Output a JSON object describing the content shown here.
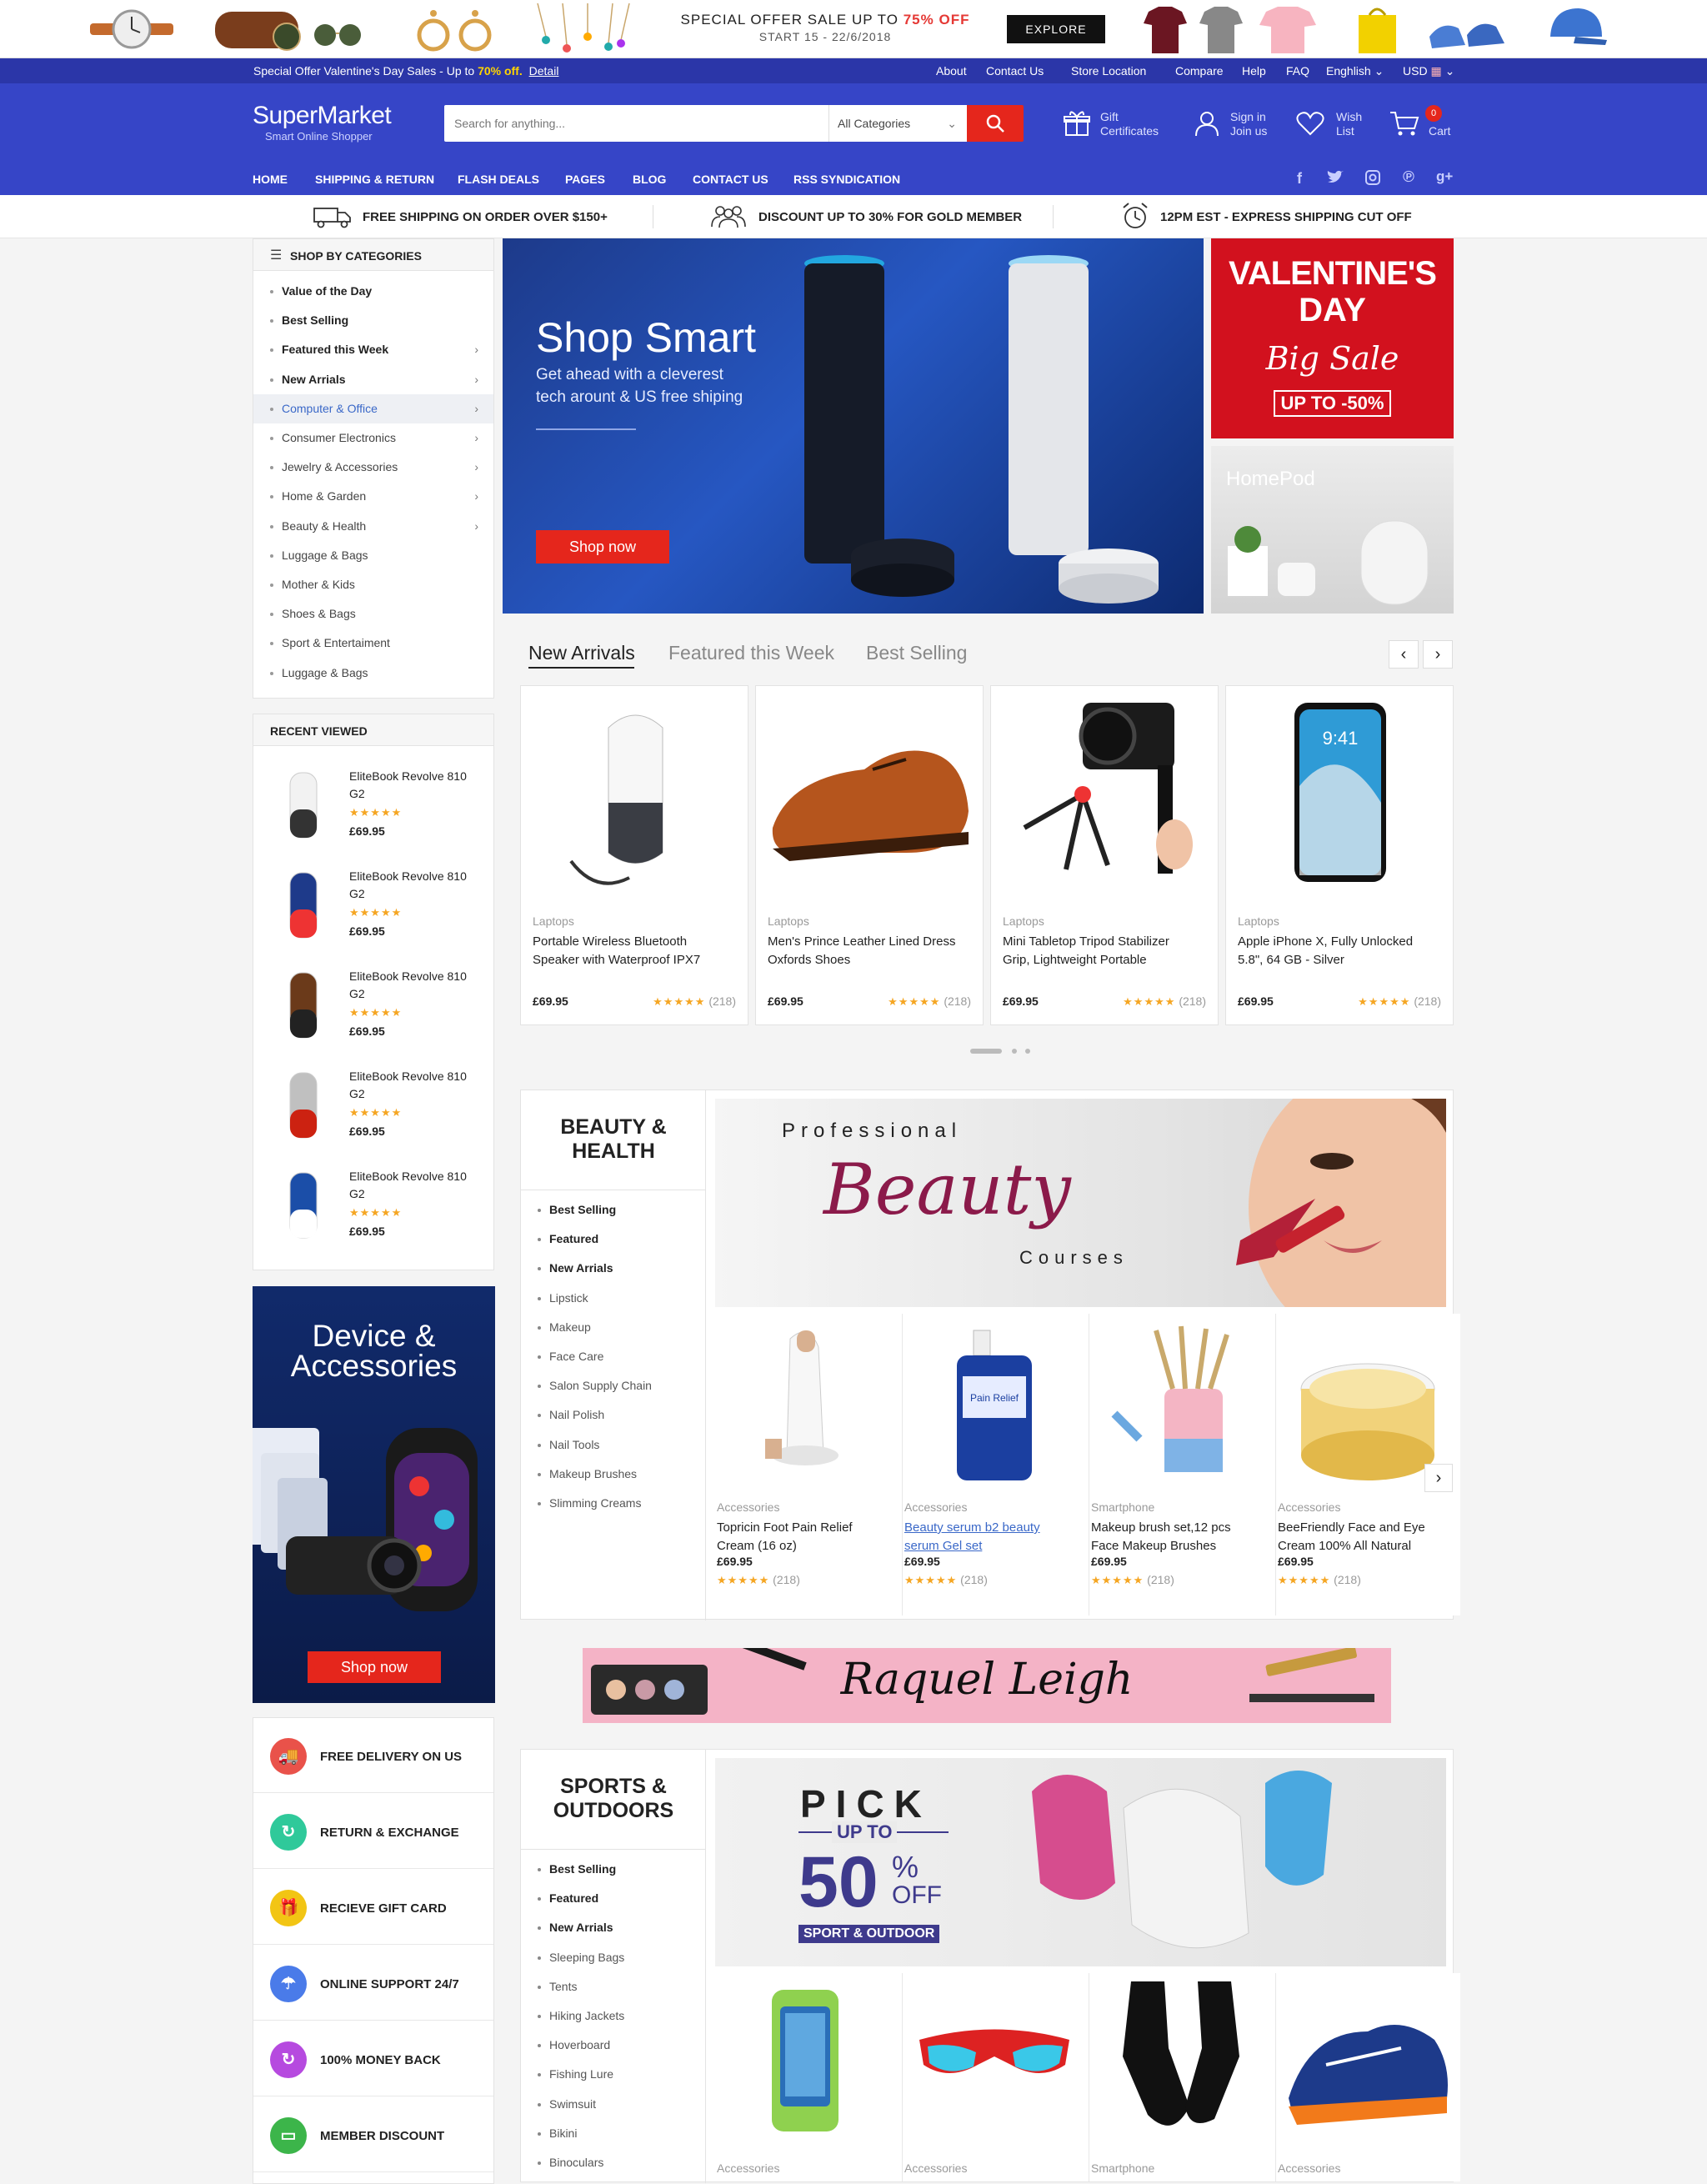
{
  "top_banner": {
    "offer_line1": "SPECIAL OFFER  SALE UP TO ",
    "offer_pct": "75% OFF",
    "offer_line2": "START 15 - 22/6/2018",
    "explore_label": "EXPLORE"
  },
  "topbar": {
    "promo_prefix": "Special Offer Valentine's Day Sales - Up to ",
    "promo_pct": "70% off.",
    "promo_link": "Detail",
    "links": [
      "About",
      "Contact Us",
      "Store Location",
      "Compare",
      "Help",
      "FAQ"
    ],
    "language": "Enghlish",
    "currency": "USD"
  },
  "header": {
    "logo": "SuperMarket",
    "tagline": "Smart Online Shopper",
    "search_placeholder": "Search for anything...",
    "category_select": "All Categories",
    "gift_line1": "Gift",
    "gift_line2": "Certificates",
    "sign_line1": "Sign in",
    "sign_line2": "Join us",
    "wish_line1": "Wish",
    "wish_line2": "List",
    "cart_label": "Cart",
    "cart_count": "0",
    "nav": [
      "HOME",
      "SHIPPING & RETURN",
      "FLASH DEALS",
      "PAGES",
      "BLOG",
      "CONTACT US",
      "RSS SYNDICATION"
    ],
    "social_icons": [
      "facebook-icon",
      "twitter-icon",
      "instagram-icon",
      "pinterest-icon",
      "google-plus-icon"
    ]
  },
  "features": [
    "FREE SHIPPING ON ORDER OVER $150+",
    "DISCOUNT UP TO 30% FOR GOLD MEMBER",
    "12PM EST - EXPRESS SHIPPING CUT OFF"
  ],
  "categories": {
    "title": "SHOP BY CATEGORIES",
    "items": [
      {
        "label": "Value of the Day",
        "arrow": false,
        "bold": true
      },
      {
        "label": "Best Selling",
        "arrow": false,
        "bold": true
      },
      {
        "label": "Featured this Week",
        "arrow": true,
        "bold": true
      },
      {
        "label": "New Arrials",
        "arrow": true,
        "bold": true
      },
      {
        "label": "Computer & Office",
        "arrow": true,
        "active": true
      },
      {
        "label": "Consumer Electronics",
        "arrow": true
      },
      {
        "label": "Jewelry & Accessories",
        "arrow": true
      },
      {
        "label": "Home & Garden",
        "arrow": true
      },
      {
        "label": "Beauty & Health",
        "arrow": true
      },
      {
        "label": "Luggage & Bags",
        "arrow": false
      },
      {
        "label": "Mother & Kids",
        "arrow": false
      },
      {
        "label": "Shoes & Bags",
        "arrow": false
      },
      {
        "label": "Sport & Entertaiment",
        "arrow": false
      },
      {
        "label": "Luggage & Bags",
        "arrow": false
      }
    ]
  },
  "hero": {
    "title": "Shop Smart",
    "subtitle_line1": "Get ahead with a cleverest",
    "subtitle_line2": "tech arount & US free shiping",
    "button": "Shop now"
  },
  "side_banners": {
    "valentine_line1": "VALENTINE'S",
    "valentine_line2": "DAY",
    "valentine_script": "Big Sale",
    "valentine_offer": "UP TO -50%",
    "homepod": "HomePod"
  },
  "recent_viewed": {
    "title": "RECENT VIEWED",
    "items": [
      {
        "name_line1": "EliteBook Revolve 810",
        "name_line2": "G2",
        "rating": "★★★★★",
        "price": "£69.95"
      },
      {
        "name_line1": "EliteBook Revolve 810",
        "name_line2": "G2",
        "rating": "★★★★★",
        "price": "£69.95"
      },
      {
        "name_line1": "EliteBook Revolve 810",
        "name_line2": "G2",
        "rating": "★★★★★",
        "price": "£69.95"
      },
      {
        "name_line1": "EliteBook Revolve 810",
        "name_line2": "G2",
        "rating": "★★★★★",
        "price": "£69.95"
      },
      {
        "name_line1": "EliteBook Revolve 810",
        "name_line2": "G2",
        "rating": "★★★★★",
        "price": "£69.95"
      }
    ]
  },
  "tabs": [
    "New Arrivals",
    "Featured this Week",
    "Best Selling"
  ],
  "new_arrivals": [
    {
      "category": "Laptops",
      "name_line1": "Portable Wireless Bluetooth",
      "name_line2": "Speaker with Waterproof IPX7",
      "price": "£69.95",
      "rating": "★★★★★",
      "reviews": "(218)"
    },
    {
      "category": "Laptops",
      "name_line1": "Men's Prince Leather Lined Dress",
      "name_line2": "Oxfords Shoes",
      "price": "£69.95",
      "rating": "★★★★★",
      "reviews": "(218)"
    },
    {
      "category": "Laptops",
      "name_line1": "Mini Tabletop Tripod Stabilizer",
      "name_line2": "Grip, Lightweight Portable",
      "price": "£69.95",
      "rating": "★★★★★",
      "reviews": "(218)"
    },
    {
      "category": "Laptops",
      "name_line1": "Apple iPhone X, Fully Unlocked",
      "name_line2": "5.8\", 64 GB - Silver",
      "price": "£69.95",
      "rating": "★★★★★",
      "reviews": "(218)"
    }
  ],
  "device_banner": {
    "line1": "Device &",
    "line2": "Accessories",
    "button": "Shop now"
  },
  "services": [
    {
      "label": "FREE DELIVERY ON US",
      "color": "#e9524a"
    },
    {
      "label": "RETURN & EXCHANGE",
      "color": "#2fc99a"
    },
    {
      "label": "RECIEVE GIFT CARD",
      "color": "#f2c514"
    },
    {
      "label": "ONLINE SUPPORT 24/7",
      "color": "#4a7be9"
    },
    {
      "label": "100% MONEY BACK",
      "color": "#b64adf"
    },
    {
      "label": "MEMBER DISCOUNT",
      "color": "#3cb54a"
    }
  ],
  "beauty": {
    "title_line1": "BEAUTY &",
    "title_line2": "HEALTH",
    "sub": [
      "Best Selling",
      "Featured",
      "New Arrials",
      "Lipstick",
      "Makeup",
      "Face Care",
      "Salon Supply Chain",
      "Nail Polish",
      "Nail Tools",
      "Makeup Brushes",
      "Slimming Creams"
    ],
    "banner_top": "Professional",
    "banner_script": "Beauty",
    "banner_bottom": "Courses",
    "products": [
      {
        "category": "Accessories",
        "name_line1": "Topricin Foot Pain Relief",
        "name_line2": "Cream (16 oz)",
        "price": "£69.95",
        "rating": "★★★★★",
        "reviews": "(218)"
      },
      {
        "category": "Accessories",
        "name_line1": "Beauty serum b2 beauty",
        "name_line2": "serum Gel set",
        "price": "£69.95",
        "rating": "★★★★★",
        "reviews": "(218)",
        "link": true
      },
      {
        "category": "Smartphone",
        "name_line1": "Makeup brush set,12 pcs",
        "name_line2": "Face Makeup Brushes",
        "price": "£69.95",
        "rating": "★★★★★",
        "reviews": "(218)"
      },
      {
        "category": "Accessories",
        "name_line1": "BeeFriendly Face and Eye",
        "name_line2": "Cream 100% All Natural",
        "price": "£69.95",
        "rating": "★★★★★",
        "reviews": "(218)"
      }
    ]
  },
  "raquel_banner": "Raquel Leigh",
  "sports": {
    "title_line1": "SPORTS &",
    "title_line2": "OUTDOORS",
    "sub": [
      "Best Selling",
      "Featured",
      "New Arrials",
      "Sleeping Bags",
      "Tents",
      "Hiking Jackets",
      "Hoverboard",
      "Fishing Lure",
      "Swimsuit",
      "Bikini",
      "Binoculars"
    ],
    "banner_pick": "PICK",
    "banner_upto": "UP TO",
    "banner_num": "50",
    "banner_pct": "%",
    "banner_off": "OFF",
    "banner_tag": "SPORT & OUTDOOR",
    "product_categories": [
      "Accessories",
      "Accessories",
      "Smartphone",
      "Accessories"
    ]
  }
}
